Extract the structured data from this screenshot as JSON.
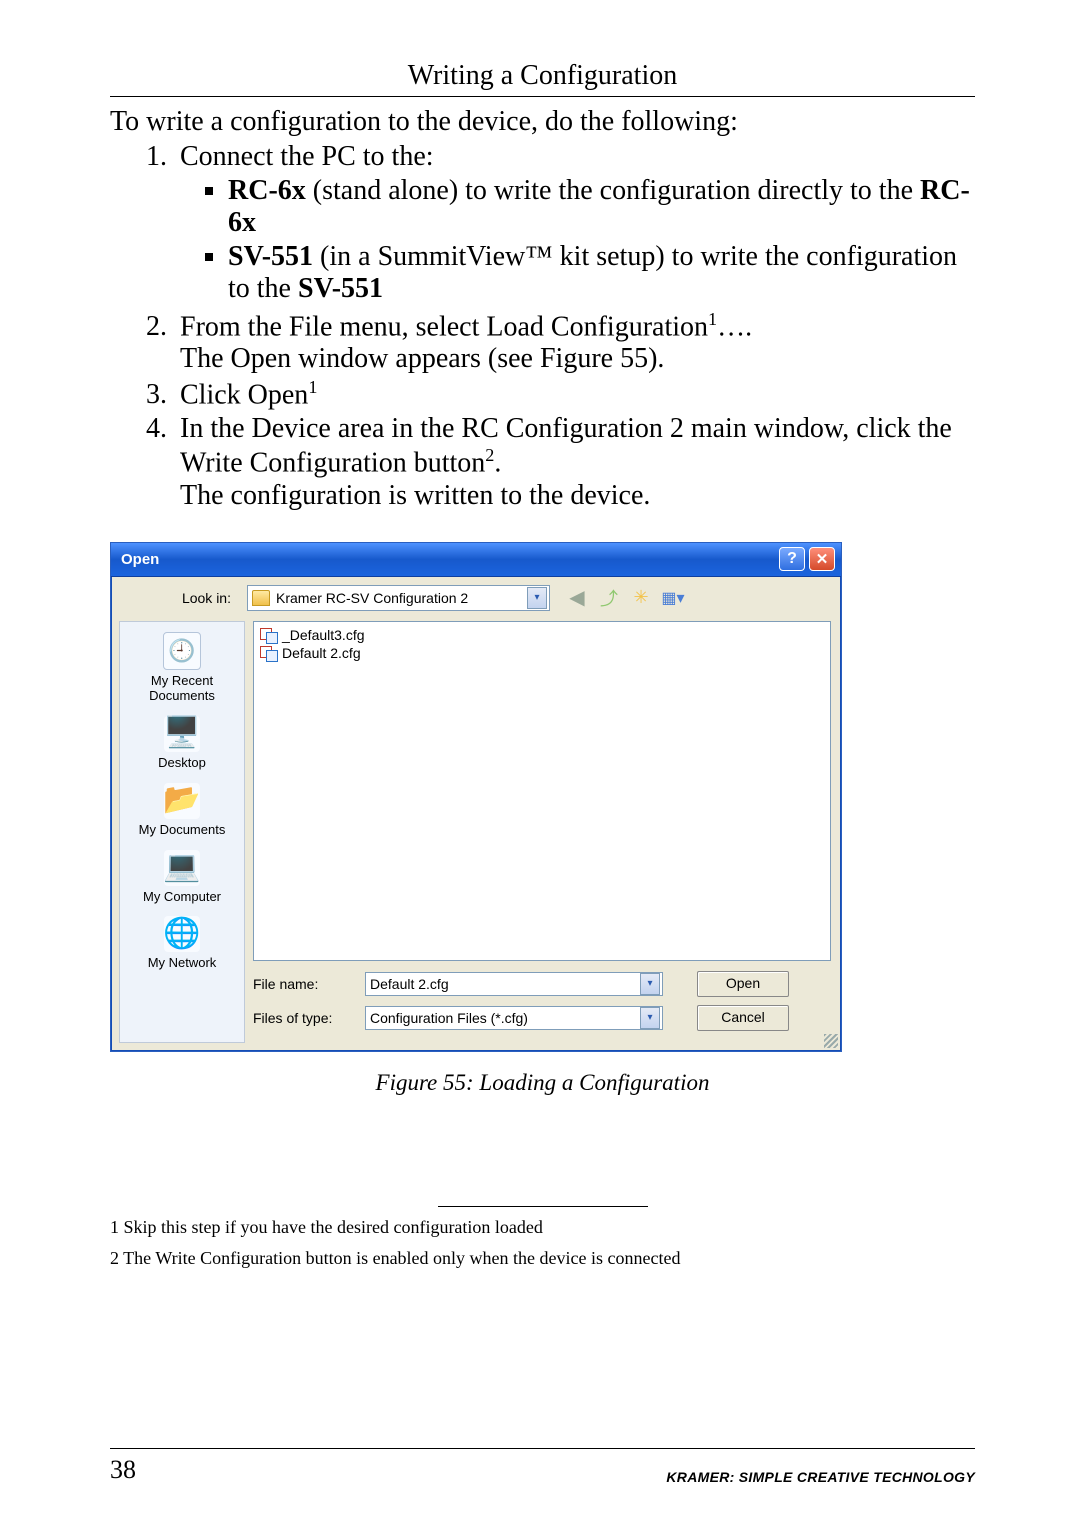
{
  "header": {
    "section_title": "Writing a Configuration"
  },
  "intro": "To write a configuration to the device, do the following:",
  "steps": {
    "s1": {
      "lead": "Connect the PC to the:",
      "b1a": "RC-6x",
      "b1b": " (stand alone) to write the configuration directly to the ",
      "b1c": "RC-6x",
      "b2a": "SV-551",
      "b2b": " (in a SummitView™ kit setup) to write the configuration to the ",
      "b2c": "SV-551"
    },
    "s2a": "From the File menu, select Load Configuration",
    "s2b": "….",
    "s2c": "The Open window appears (see Figure 55).",
    "s3a": "Click Open",
    "s4a": "In the Device area in the RC Configuration 2 main window, click the Write Configuration button",
    "s4b": ".",
    "s4c": "The configuration is written to the device."
  },
  "dialog": {
    "title": "Open",
    "look_in_label": "Look in:",
    "look_in_value": "Kramer RC-SV Configuration 2",
    "places": {
      "recent": "My Recent Documents",
      "desktop": "Desktop",
      "docs": "My Documents",
      "comp": "My Computer",
      "net": "My Network"
    },
    "files": [
      "_Default3.cfg",
      "Default 2.cfg"
    ],
    "file_name_label": "File name:",
    "file_name_value": "Default 2.cfg",
    "file_type_label": "Files of type:",
    "file_type_value": "Configuration Files (*.cfg)",
    "open_btn": "Open",
    "cancel_btn": "Cancel"
  },
  "caption": "Figure 55: Loading a Configuration",
  "footnotes": {
    "f1": "1 Skip this step if you have the desired configuration loaded",
    "f2": "2 The Write Configuration button is enabled only when the device is connected"
  },
  "footer": {
    "page": "38",
    "brand": "KRAMER:  SIMPLE CREATIVE TECHNOLOGY"
  }
}
